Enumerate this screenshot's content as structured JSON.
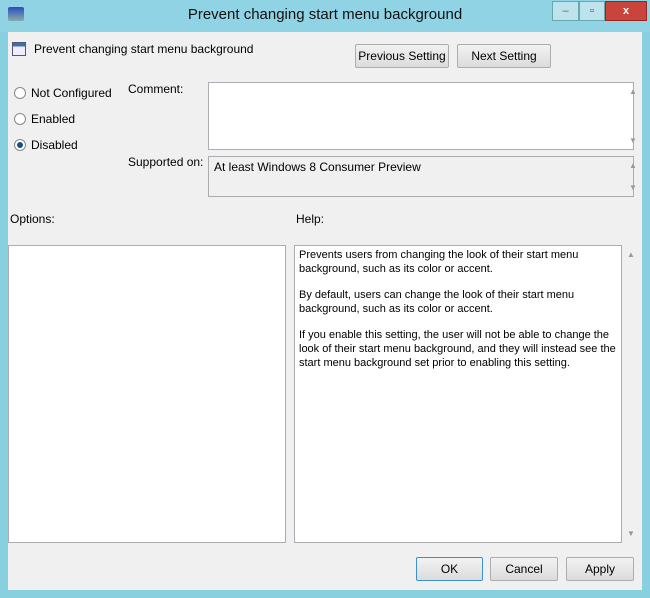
{
  "window": {
    "title": "Prevent changing start menu background",
    "minimize": "–",
    "maximize": "▫",
    "close": "x"
  },
  "header": {
    "policy_name": "Prevent changing start menu background",
    "previous": "Previous Setting",
    "next": "Next Setting"
  },
  "state": {
    "options": [
      {
        "label": "Not Configured",
        "selected": false
      },
      {
        "label": "Enabled",
        "selected": false
      },
      {
        "label": "Disabled",
        "selected": true
      }
    ]
  },
  "comment": {
    "label": "Comment:",
    "value": ""
  },
  "supported": {
    "label": "Supported on:",
    "value": "At least Windows 8 Consumer Preview"
  },
  "options_label": "Options:",
  "help": {
    "label": "Help:",
    "paragraphs": [
      "Prevents users from changing the look of their start menu background, such as its color or accent.",
      "By default, users can change the look of their start menu background, such as its color or accent.",
      "If you enable this setting, the user will not be able to change the look of their start menu background, and they will instead see the start menu background set prior to enabling this setting."
    ]
  },
  "footer": {
    "ok": "OK",
    "cancel": "Cancel",
    "apply": "Apply"
  }
}
